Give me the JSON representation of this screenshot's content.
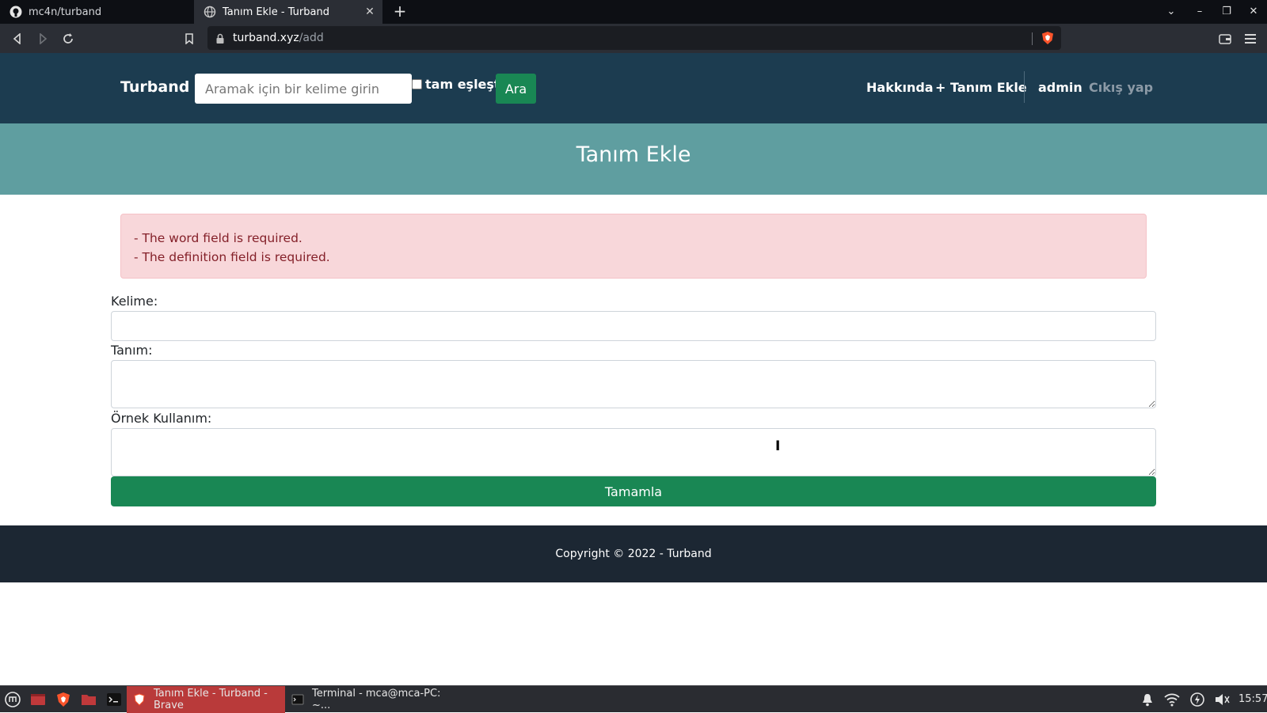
{
  "browser": {
    "tabs": [
      {
        "title": "mc4n/turband",
        "icon": "github-icon"
      },
      {
        "title": "Tanım Ekle - Turband",
        "icon": "globe-icon",
        "active": true
      }
    ],
    "url_host": "turband.xyz",
    "url_path": "/add"
  },
  "navbar": {
    "brand": "Turband",
    "search_placeholder": "Aramak için bir kelime girin",
    "exact_match_label": "tam eşleştir",
    "search_button": "Ara",
    "links": {
      "about": "Hakkında",
      "add_definition": "+ Tanım Ekle",
      "user": "admin",
      "logout": "Cıkış yap"
    }
  },
  "page": {
    "title": "Tanım Ekle",
    "errors": [
      "- The word field is required.",
      "- The definition field is required."
    ],
    "form": {
      "word_label": "Kelime:",
      "word_value": "",
      "definition_label": "Tanım:",
      "definition_value": "",
      "example_label": "Örnek Kullanım:",
      "example_value": "",
      "submit_label": "Tamamla"
    }
  },
  "footer": {
    "copyright": "Copyright © 2022 - Turband"
  },
  "taskbar": {
    "tasks": [
      {
        "title": "Tanım Ekle - Turband - Brave",
        "active": true
      },
      {
        "title": "Terminal - mca@mca-PC: ~...",
        "active": false
      }
    ],
    "clock": "15:57"
  },
  "colors": {
    "navbar_bg": "#1c3c50",
    "banner_bg": "#5f9ea0",
    "success_green": "#198754",
    "alert_bg": "#f8d7da",
    "alert_text": "#842029",
    "footer_bg": "#1c2733"
  }
}
